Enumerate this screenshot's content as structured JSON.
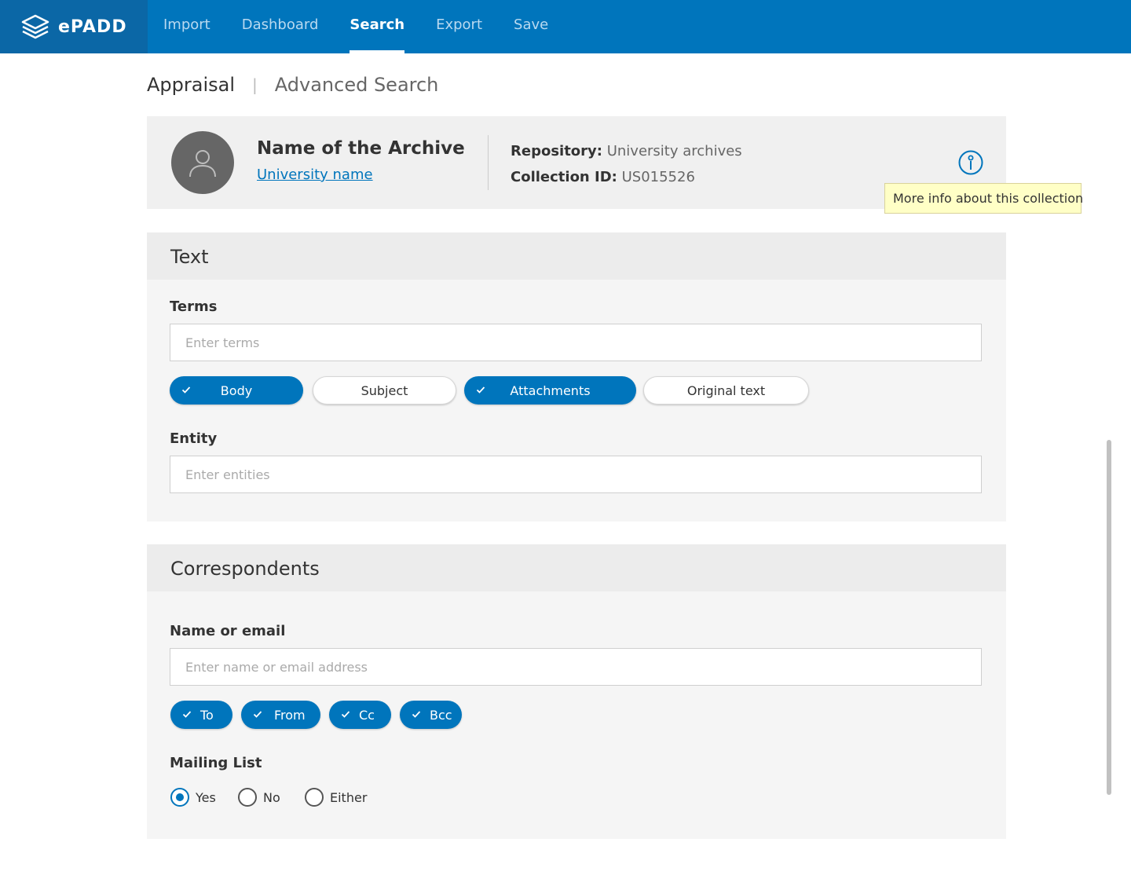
{
  "brand": {
    "logo_text": "ePADD"
  },
  "nav": {
    "items": [
      {
        "label": "Import"
      },
      {
        "label": "Dashboard"
      },
      {
        "label": "Search"
      },
      {
        "label": "Export"
      },
      {
        "label": "Save"
      }
    ],
    "active": "Search"
  },
  "breadcrumb": {
    "current": "Appraisal",
    "separator": "|",
    "link": "Advanced Search"
  },
  "archive": {
    "name": "Name of the Archive",
    "university": "University name",
    "repository_label": "Repository:",
    "repository_value": "University archives",
    "collection_label": "Collection ID:",
    "collection_value": "US015526",
    "info_tooltip": "More info about this collection"
  },
  "text_section": {
    "title": "Text",
    "terms_label": "Terms",
    "terms_placeholder": "Enter terms",
    "terms_value": "",
    "scopes": [
      {
        "label": "Body",
        "selected": true
      },
      {
        "label": "Subject",
        "selected": false
      },
      {
        "label": "Attachments",
        "selected": true
      },
      {
        "label": "Original text",
        "selected": false
      }
    ],
    "entity_label": "Entity",
    "entity_placeholder": "Enter entities",
    "entity_value": ""
  },
  "correspondents_section": {
    "title": "Correspondents",
    "name_label": "Name or email",
    "name_placeholder": "Enter name or email address",
    "name_value": "",
    "fields": [
      {
        "label": "To",
        "selected": true
      },
      {
        "label": "From",
        "selected": true
      },
      {
        "label": "Cc",
        "selected": true
      },
      {
        "label": "Bcc",
        "selected": true
      }
    ],
    "mailing_list_label": "Mailing List",
    "mailing_list_options": [
      {
        "label": "Yes",
        "selected": true
      },
      {
        "label": "No",
        "selected": false
      },
      {
        "label": "Either",
        "selected": false
      }
    ]
  },
  "colors": {
    "primary": "#0075bc",
    "header_dark": "#0b67a6",
    "tooltip_bg": "#ffffc6"
  },
  "icons": {
    "logo": "epadd-logo-icon",
    "avatar": "user-avatar-icon",
    "info": "info-icon",
    "check": "check-icon"
  }
}
